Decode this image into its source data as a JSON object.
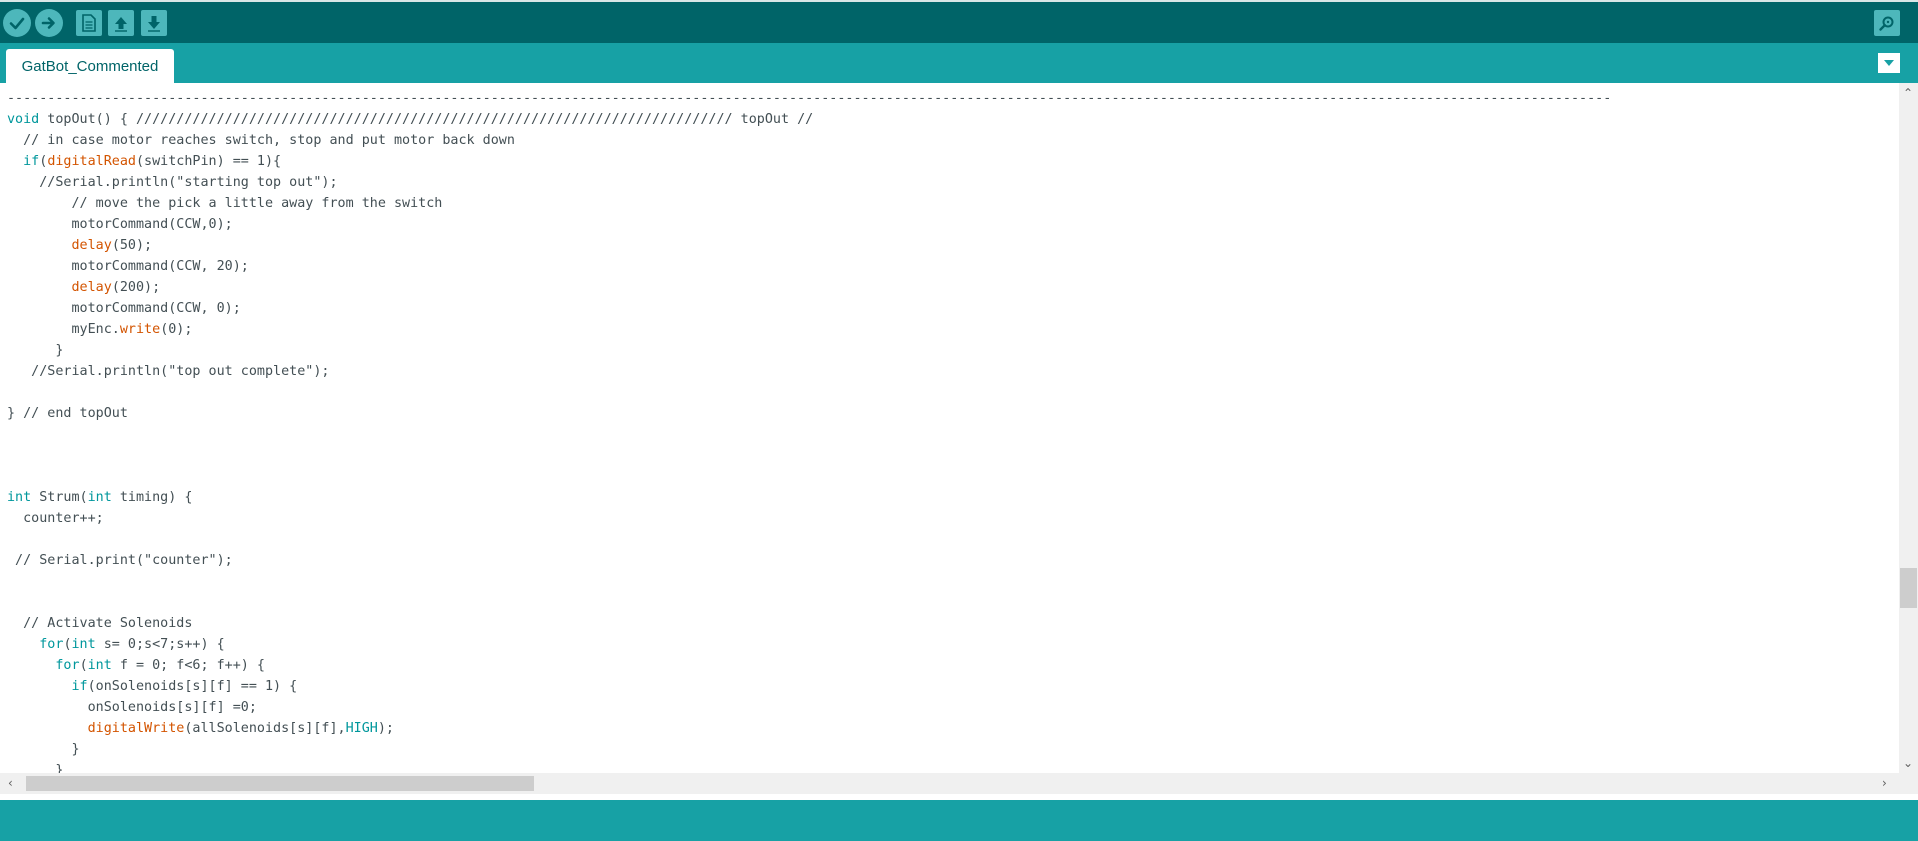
{
  "toolbar": {
    "buttons": [
      {
        "name": "verify",
        "icon": "checkmark-icon"
      },
      {
        "name": "upload",
        "icon": "arrow-right-icon"
      },
      {
        "name": "new",
        "icon": "new-file-icon"
      },
      {
        "name": "open",
        "icon": "arrow-up-icon"
      },
      {
        "name": "save",
        "icon": "arrow-down-icon"
      }
    ],
    "serial_monitor_icon": "magnifier-icon"
  },
  "tabs": [
    {
      "label": "GatBot_Commented",
      "active": true
    }
  ],
  "colors": {
    "toolbar_bg": "#006468",
    "tabbar_bg": "#17a1a5",
    "keyword": "#00979c",
    "function": "#d35400",
    "text": "#434f54"
  },
  "editor": {
    "lines": [
      [
        {
          "t": "-------------------------------------------------------------------------------------------------------------------------------------------------------------------------------------------------------",
          "c": "cm"
        }
      ],
      [
        {
          "t": "void",
          "c": "kw"
        },
        {
          "t": " topOut() { ////////////////////////////////////////////////////////////////////////// topOut //",
          "c": ""
        }
      ],
      [
        {
          "t": "  // in case motor reaches switch, stop and put motor back down",
          "c": "cm"
        }
      ],
      [
        {
          "t": "  ",
          "c": ""
        },
        {
          "t": "if",
          "c": "kw"
        },
        {
          "t": "(",
          "c": ""
        },
        {
          "t": "digitalRead",
          "c": "fn"
        },
        {
          "t": "(switchPin) == 1){",
          "c": ""
        }
      ],
      [
        {
          "t": "    //Serial.println(\"starting top out\");",
          "c": "cm"
        }
      ],
      [
        {
          "t": "        // move the pick a little away from the switch",
          "c": "cm"
        }
      ],
      [
        {
          "t": "        motorCommand(CCW,0);",
          "c": ""
        }
      ],
      [
        {
          "t": "        ",
          "c": ""
        },
        {
          "t": "delay",
          "c": "fn"
        },
        {
          "t": "(50);",
          "c": ""
        }
      ],
      [
        {
          "t": "        motorCommand(CCW, 20);",
          "c": ""
        }
      ],
      [
        {
          "t": "        ",
          "c": ""
        },
        {
          "t": "delay",
          "c": "fn"
        },
        {
          "t": "(200);",
          "c": ""
        }
      ],
      [
        {
          "t": "        motorCommand(CCW, 0);",
          "c": ""
        }
      ],
      [
        {
          "t": "        myEnc.",
          "c": ""
        },
        {
          "t": "write",
          "c": "fn"
        },
        {
          "t": "(0);",
          "c": ""
        }
      ],
      [
        {
          "t": "      }",
          "c": ""
        }
      ],
      [
        {
          "t": "   //Serial.println(\"top out complete\");",
          "c": "cm"
        }
      ],
      [
        {
          "t": "",
          "c": ""
        }
      ],
      [
        {
          "t": "} // end topOut",
          "c": ""
        }
      ],
      [
        {
          "t": "",
          "c": ""
        }
      ],
      [
        {
          "t": "",
          "c": ""
        }
      ],
      [
        {
          "t": "",
          "c": ""
        }
      ],
      [
        {
          "t": "int",
          "c": "kw"
        },
        {
          "t": " Strum(",
          "c": ""
        },
        {
          "t": "int",
          "c": "kw"
        },
        {
          "t": " timing) {",
          "c": ""
        }
      ],
      [
        {
          "t": "  counter++;",
          "c": ""
        }
      ],
      [
        {
          "t": "",
          "c": ""
        }
      ],
      [
        {
          "t": " // Serial.print(\"counter\");",
          "c": "cm"
        }
      ],
      [
        {
          "t": "",
          "c": ""
        }
      ],
      [
        {
          "t": "",
          "c": ""
        }
      ],
      [
        {
          "t": "  // Activate Solenoids",
          "c": "cm"
        }
      ],
      [
        {
          "t": "    ",
          "c": ""
        },
        {
          "t": "for",
          "c": "kw"
        },
        {
          "t": "(",
          "c": ""
        },
        {
          "t": "int",
          "c": "kw"
        },
        {
          "t": " s= 0;s<7;s++) {",
          "c": ""
        }
      ],
      [
        {
          "t": "      ",
          "c": ""
        },
        {
          "t": "for",
          "c": "kw"
        },
        {
          "t": "(",
          "c": ""
        },
        {
          "t": "int",
          "c": "kw"
        },
        {
          "t": " f = 0; f<6; f++) {",
          "c": ""
        }
      ],
      [
        {
          "t": "        ",
          "c": ""
        },
        {
          "t": "if",
          "c": "kw"
        },
        {
          "t": "(onSolenoids[s][f] == 1) {",
          "c": ""
        }
      ],
      [
        {
          "t": "          onSolenoids[s][f] =0;",
          "c": ""
        }
      ],
      [
        {
          "t": "          ",
          "c": ""
        },
        {
          "t": "digitalWrite",
          "c": "fn"
        },
        {
          "t": "(allSolenoids[s][f],",
          "c": ""
        },
        {
          "t": "HIGH",
          "c": "kw"
        },
        {
          "t": ");",
          "c": ""
        }
      ],
      [
        {
          "t": "        }",
          "c": ""
        }
      ],
      [
        {
          "t": "      }",
          "c": ""
        }
      ]
    ]
  },
  "scrollbars": {
    "vertical_position": 0.72,
    "horizontal_position": 0.0
  }
}
